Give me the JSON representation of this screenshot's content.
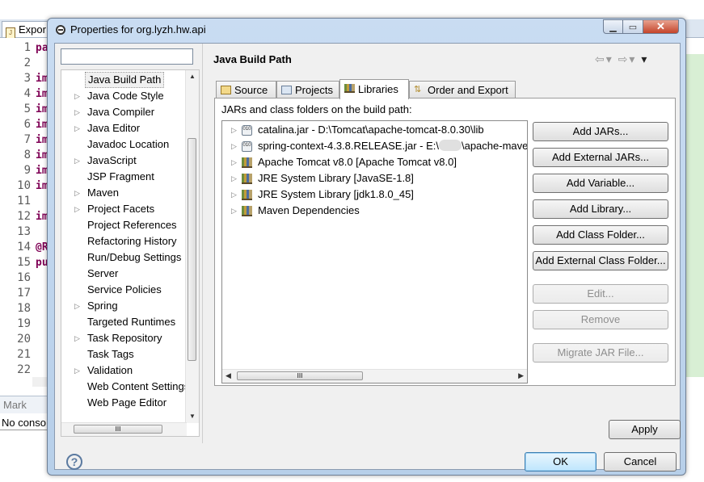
{
  "background": {
    "editor_tab_label": "Expor",
    "lines": [
      {
        "num": "1",
        "code": "pa"
      },
      {
        "num": "2",
        "code": ""
      },
      {
        "num": "3",
        "code": "im"
      },
      {
        "num": "4",
        "code": "im"
      },
      {
        "num": "5",
        "code": "im"
      },
      {
        "num": "6",
        "code": "im"
      },
      {
        "num": "7",
        "code": "im"
      },
      {
        "num": "8",
        "code": "im"
      },
      {
        "num": "9",
        "code": "im"
      },
      {
        "num": "10",
        "code": "im"
      },
      {
        "num": "11",
        "code": ""
      },
      {
        "num": "12",
        "code": "im"
      },
      {
        "num": "13",
        "code": ""
      },
      {
        "num": "14",
        "code": "@R"
      },
      {
        "num": "15",
        "code": "pu"
      },
      {
        "num": "16",
        "code": ""
      },
      {
        "num": "17",
        "code": ""
      },
      {
        "num": "18",
        "code": ""
      },
      {
        "num": "19",
        "code": ""
      },
      {
        "num": "20",
        "code": ""
      },
      {
        "num": "21",
        "code": ""
      },
      {
        "num": "22",
        "code": ""
      }
    ],
    "markers_label": "Mark",
    "console_text": "No conso"
  },
  "dialog": {
    "title": "Properties for org.lyzh.hw.api",
    "filter_value": "",
    "tree": [
      {
        "label": "Java Build Path",
        "expandable": false,
        "selected": true
      },
      {
        "label": "Java Code Style",
        "expandable": true
      },
      {
        "label": "Java Compiler",
        "expandable": true
      },
      {
        "label": "Java Editor",
        "expandable": true
      },
      {
        "label": "Javadoc Location",
        "expandable": false
      },
      {
        "label": "JavaScript",
        "expandable": true
      },
      {
        "label": "JSP Fragment",
        "expandable": false
      },
      {
        "label": "Maven",
        "expandable": true
      },
      {
        "label": "Project Facets",
        "expandable": true
      },
      {
        "label": "Project References",
        "expandable": false
      },
      {
        "label": "Refactoring History",
        "expandable": false
      },
      {
        "label": "Run/Debug Settings",
        "expandable": false
      },
      {
        "label": "Server",
        "expandable": false
      },
      {
        "label": "Service Policies",
        "expandable": false
      },
      {
        "label": "Spring",
        "expandable": true
      },
      {
        "label": "Targeted Runtimes",
        "expandable": false
      },
      {
        "label": "Task Repository",
        "expandable": true
      },
      {
        "label": "Task Tags",
        "expandable": false
      },
      {
        "label": "Validation",
        "expandable": true
      },
      {
        "label": "Web Content Settings",
        "expandable": false
      },
      {
        "label": "Web Page Editor",
        "expandable": false
      }
    ],
    "page_title": "Java Build Path",
    "tabs": [
      {
        "label": "Source",
        "icon": "source-folder-icon"
      },
      {
        "label": "Projects",
        "icon": "projects-icon"
      },
      {
        "label": "Libraries",
        "icon": "libraries-icon",
        "active": true
      },
      {
        "label": "Order and Export",
        "icon": "order-export-icon"
      }
    ],
    "panel_label": "JARs and class folders on the build path:",
    "libraries": [
      {
        "label": "catalina.jar - D:\\Tomcat\\apache-tomcat-8.0.30\\lib",
        "icon": "jar-icon"
      },
      {
        "label_before": "spring-context-4.3.8.RELEASE.jar - E:\\",
        "label_after": "\\apache-maven",
        "icon": "jar-icon"
      },
      {
        "label": "Apache Tomcat v8.0 [Apache Tomcat v8.0]",
        "icon": "library-icon"
      },
      {
        "label": "JRE System Library [JavaSE-1.8]",
        "icon": "library-icon"
      },
      {
        "label": "JRE System Library [jdk1.8.0_45]",
        "icon": "library-icon"
      },
      {
        "label": "Maven Dependencies",
        "icon": "library-icon"
      }
    ],
    "side_buttons": [
      {
        "label": "Add JARs...",
        "enabled": true
      },
      {
        "label": "Add External JARs...",
        "enabled": true
      },
      {
        "label": "Add Variable...",
        "enabled": true
      },
      {
        "label": "Add Library...",
        "enabled": true
      },
      {
        "label": "Add Class Folder...",
        "enabled": true
      },
      {
        "label": "Add External Class Folder...",
        "enabled": true
      },
      {
        "label": "Edit...",
        "enabled": false
      },
      {
        "label": "Remove",
        "enabled": false
      },
      {
        "label": "Migrate JAR File...",
        "enabled": false
      }
    ],
    "apply_label": "Apply",
    "ok_label": "OK",
    "cancel_label": "Cancel",
    "help_glyph": "?",
    "scroll_thumb_glyph": "III"
  }
}
